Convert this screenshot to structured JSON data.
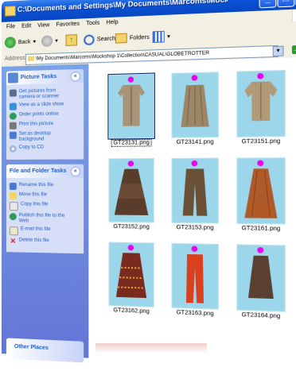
{
  "window": {
    "title": "C:\\Documents and Settings\\My Documents\\Marcoms\\Mockshop - S...",
    "minimize_glyph": "_",
    "maximize_glyph": "□",
    "close_glyph": "X"
  },
  "menu": [
    "File",
    "Edit",
    "View",
    "Favorites",
    "Tools",
    "Help"
  ],
  "toolbar": {
    "back_label": "Back",
    "search_label": "Search",
    "folders_label": "Folders"
  },
  "address": {
    "label": "Address",
    "value": "\\My Documents\\Marcoms\\Mockshop 1\\Collection\\CASUAL\\GLOBETROTTER",
    "go_label": "Go"
  },
  "picture_tasks": {
    "title": "Picture Tasks",
    "items": [
      {
        "label": "Get pictures from\ncamera or scanner",
        "icon": "camera-icon"
      },
      {
        "label": "View as a slide show",
        "icon": "slideshow-icon"
      },
      {
        "label": "Order prints online",
        "icon": "globe-icon"
      },
      {
        "label": "Print this picture",
        "icon": "printer-icon"
      },
      {
        "label": "Set as desktop\nbackground",
        "icon": "desktop-icon"
      },
      {
        "label": "Copy to CD",
        "icon": "cd-icon"
      }
    ]
  },
  "file_tasks": {
    "title": "File and Folder Tasks",
    "items": [
      {
        "label": "Rename this file",
        "icon": "rename-icon"
      },
      {
        "label": "Move this file",
        "icon": "move-icon"
      },
      {
        "label": "Copy this file",
        "icon": "copy-icon"
      },
      {
        "label": "Publish this file to the\nWeb",
        "icon": "publish-icon"
      },
      {
        "label": "E-mail this file",
        "icon": "email-icon"
      },
      {
        "label": "Delete this file",
        "icon": "delete-icon"
      }
    ]
  },
  "other_places": {
    "title": "Other Places"
  },
  "files": [
    {
      "name": "GT23131.png",
      "selected": true,
      "garment": "khaki shirt dress",
      "color": "#a89478"
    },
    {
      "name": "GT23141.png",
      "selected": false,
      "garment": "pleated skirt",
      "color": "#9c8668"
    },
    {
      "name": "GT23151.png",
      "selected": false,
      "garment": "short-sleeve shirt",
      "color": "#b09a78"
    },
    {
      "name": "GT23152.png",
      "selected": false,
      "garment": "tiered skirt",
      "color": "#5a3c2a"
    },
    {
      "name": "GT23153.png",
      "selected": false,
      "garment": "wide trousers",
      "color": "#6a5036"
    },
    {
      "name": "GT23161.png",
      "selected": false,
      "garment": "maxi skirt",
      "color": "#b05a2a"
    },
    {
      "name": "GT23162.png",
      "selected": false,
      "garment": "patterned skirt",
      "color": "#7a2a1e"
    },
    {
      "name": "GT23163.png",
      "selected": false,
      "garment": "red trousers",
      "color": "#d8401e"
    },
    {
      "name": "GT23164.png",
      "selected": false,
      "garment": "skirt",
      "color": "#5a4030"
    }
  ]
}
